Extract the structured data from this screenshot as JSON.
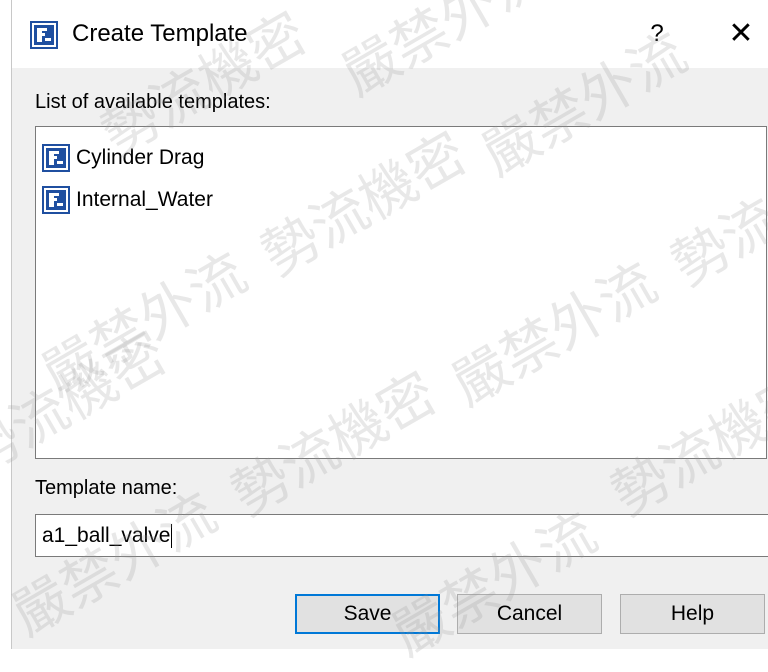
{
  "window": {
    "title": "Create Template",
    "help_glyph": "?",
    "close_glyph": "✕"
  },
  "list_label": "List of available templates:",
  "templates": [
    {
      "label": "Cylinder Drag",
      "icon": "template-icon"
    },
    {
      "label": "Internal_Water",
      "icon": "template-icon"
    }
  ],
  "name_label": "Template name:",
  "name_input": {
    "value": "a1_ball_valve"
  },
  "buttons": {
    "save": "Save",
    "cancel": "Cancel",
    "help": "Help"
  },
  "watermark": [
    "勢流機密",
    "嚴禁外流"
  ],
  "colors": {
    "icon_blue": "#1f4fa0",
    "focus_border": "#0078d7"
  }
}
